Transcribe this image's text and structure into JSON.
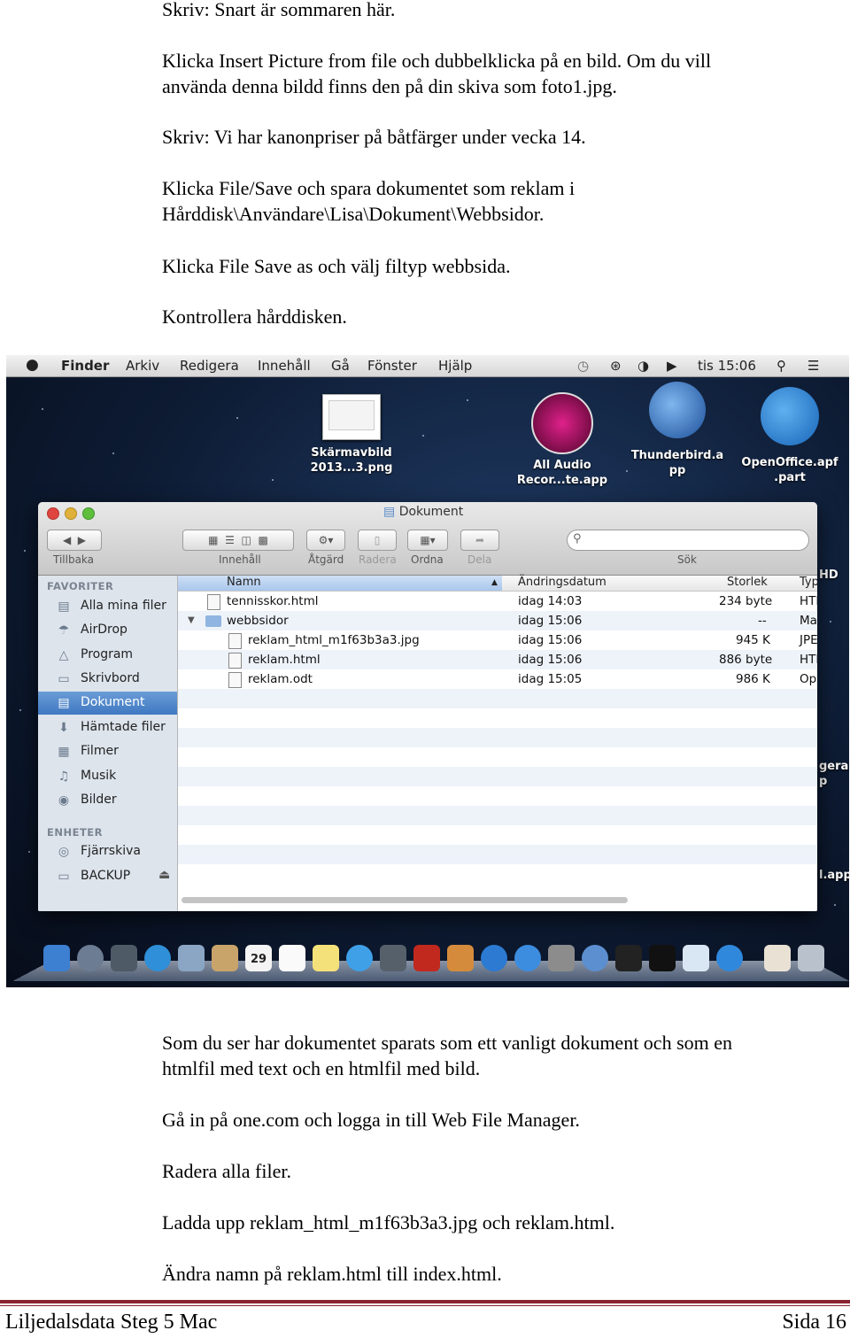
{
  "paragraphs_top": [
    {
      "lines": [
        "Skriv: Snart är sommaren här."
      ]
    },
    {
      "lines": [
        "Klicka Insert Picture from file och dubbelklicka på en bild. Om du vill",
        "använda denna bildd finns den på din skiva som foto1.jpg."
      ]
    },
    {
      "lines": [
        "Skriv:  Vi har kanonpriser på båtfärger under vecka 14."
      ]
    },
    {
      "lines": [
        "Klicka File/Save och spara dokumentet som reklam i",
        "Hårddisk\\Användare\\Lisa\\Dokument\\Webbsidor."
      ]
    },
    {
      "lines": [
        "Klicka File Save as och välj filtyp webbsida."
      ]
    },
    {
      "lines": [
        "Kontrollera hårddisken."
      ]
    }
  ],
  "screenshot": {
    "menubar": {
      "apple": "",
      "items": [
        "Finder",
        "Arkiv",
        "Redigera",
        "Innehåll",
        "Gå",
        "Fönster",
        "Hjälp"
      ],
      "clock": "tis 15:06"
    },
    "desktop_icons": [
      {
        "label_lines": [
          "Skärmavbild",
          "2013...3.png"
        ],
        "icon": "screenshot-file-icon"
      },
      {
        "label_lines": [
          "All Audio",
          "Recor...te.app"
        ],
        "icon": "audio-recorder-icon"
      },
      {
        "label_lines": [
          "Thunderbird.a",
          "pp"
        ],
        "icon": "thunderbird-icon"
      },
      {
        "label_lines": [
          "OpenOffice.apf",
          ".part"
        ],
        "icon": "openoffice-icon"
      }
    ],
    "desktop_partial_labels": [
      "HD",
      "gerar",
      "p",
      "l.app"
    ],
    "window": {
      "title": "Dokument",
      "toolbar_labels": [
        "Tillbaka",
        "Innehåll",
        "Åtgärd",
        "Radera",
        "Ordna",
        "Dela",
        "Sök"
      ],
      "sidebar": {
        "favorites_header": "FAVORITER",
        "favorites": [
          {
            "label": "Alla mina filer",
            "icon": "all-files-icon"
          },
          {
            "label": "AirDrop",
            "icon": "airdrop-icon"
          },
          {
            "label": "Program",
            "icon": "applications-icon"
          },
          {
            "label": "Skrivbord",
            "icon": "desktop-icon"
          },
          {
            "label": "Dokument",
            "icon": "documents-icon",
            "selected": true
          },
          {
            "label": "Hämtade filer",
            "icon": "downloads-icon"
          },
          {
            "label": "Filmer",
            "icon": "movies-icon"
          },
          {
            "label": "Musik",
            "icon": "music-icon"
          },
          {
            "label": "Bilder",
            "icon": "pictures-icon"
          }
        ],
        "devices_header": "ENHETER",
        "devices": [
          {
            "label": "Fjärrskiva",
            "icon": "remote-disc-icon"
          },
          {
            "label": "BACKUP",
            "icon": "drive-icon"
          }
        ]
      },
      "columns": [
        "Namn",
        "Ändringsdatum",
        "Storlek",
        "Typ"
      ],
      "rows": [
        {
          "name": "tennisskor.html",
          "date": "idag 14:03",
          "size": "234 byte",
          "type": "HTI",
          "indent": 0,
          "icon": "html-file-icon"
        },
        {
          "name": "webbsidor",
          "date": "idag 15:06",
          "size": "--",
          "type": "Map",
          "indent": 0,
          "icon": "folder-icon",
          "expanded": true
        },
        {
          "name": "reklam_html_m1f63b3a3.jpg",
          "date": "idag 15:06",
          "size": "945 K",
          "type": "JPEG",
          "indent": 1,
          "icon": "jpg-file-icon"
        },
        {
          "name": "reklam.html",
          "date": "idag 15:06",
          "size": "886 byte",
          "type": "HTI",
          "indent": 1,
          "icon": "html-file-icon"
        },
        {
          "name": "reklam.odt",
          "date": "idag 15:05",
          "size": "986 K",
          "type": "OpeP",
          "indent": 1,
          "icon": "odt-file-icon"
        }
      ]
    },
    "dock_texts": [
      "29"
    ]
  },
  "paragraphs_bottom": [
    {
      "lines": [
        "Som du ser har dokumentet sparats som ett vanligt dokument och som en",
        "htmlfil med text och en htmlfil med bild."
      ]
    },
    {
      "lines": [
        "Gå in på one.com och logga in till Web File Manager."
      ]
    },
    {
      "lines": [
        "Radera alla filer."
      ]
    },
    {
      "lines": [
        "Ladda upp reklam_html_m1f63b3a3.jpg och reklam.html."
      ]
    },
    {
      "lines": [
        "Ändra namn på reklam.html till index.html."
      ]
    }
  ],
  "footer": {
    "left": "Liljedalsdata Steg 5 Mac",
    "right": "Sida 16"
  },
  "colors": {
    "rule": "#8a2430",
    "selection": "#3f78c2",
    "sidebar": "#dde4ec"
  }
}
